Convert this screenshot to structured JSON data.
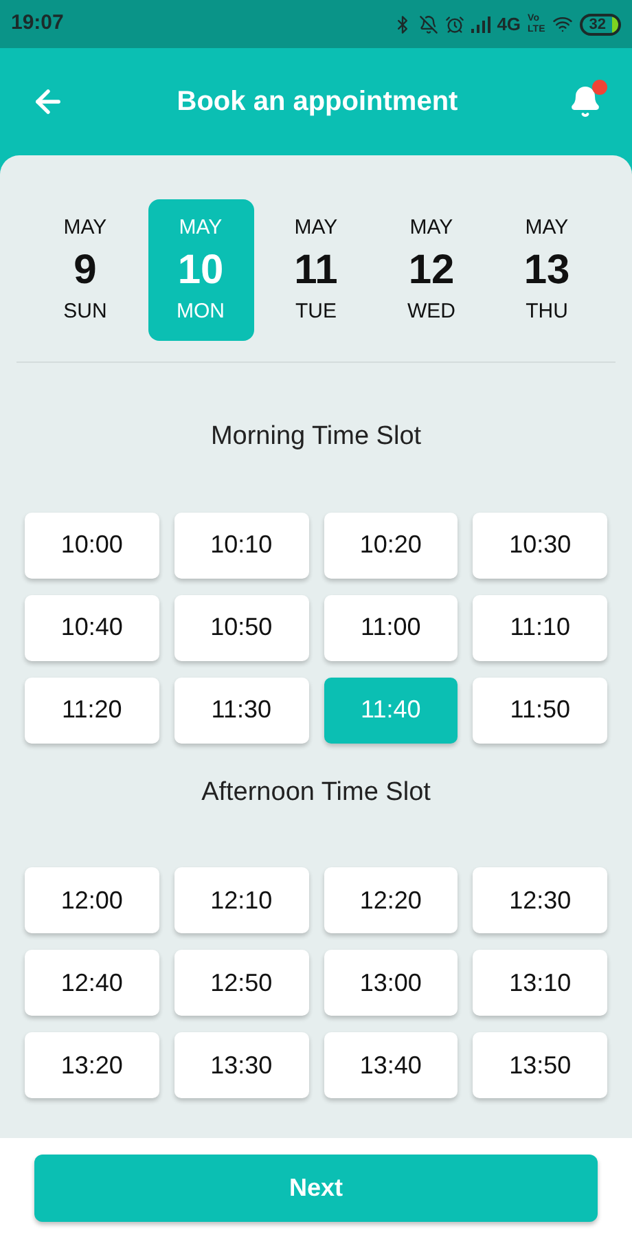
{
  "status_bar": {
    "time": "19:07",
    "network": "4G",
    "volte": [
      "Vo",
      "LTE"
    ],
    "battery": "32"
  },
  "header": {
    "title": "Book an appointment",
    "notification": true
  },
  "dates": [
    {
      "month": "MAY",
      "day": "9",
      "weekday": "SUN",
      "selected": false
    },
    {
      "month": "MAY",
      "day": "10",
      "weekday": "MON",
      "selected": true
    },
    {
      "month": "MAY",
      "day": "11",
      "weekday": "TUE",
      "selected": false
    },
    {
      "month": "MAY",
      "day": "12",
      "weekday": "WED",
      "selected": false
    },
    {
      "month": "MAY",
      "day": "13",
      "weekday": "THU",
      "selected": false
    }
  ],
  "sections": [
    {
      "title": "Morning Time Slot",
      "slots": [
        {
          "time": "10:00",
          "selected": false
        },
        {
          "time": "10:10",
          "selected": false
        },
        {
          "time": "10:20",
          "selected": false
        },
        {
          "time": "10:30",
          "selected": false
        },
        {
          "time": "10:40",
          "selected": false
        },
        {
          "time": "10:50",
          "selected": false
        },
        {
          "time": "11:00",
          "selected": false
        },
        {
          "time": "11:10",
          "selected": false
        },
        {
          "time": "11:20",
          "selected": false
        },
        {
          "time": "11:30",
          "selected": false
        },
        {
          "time": "11:40",
          "selected": true
        },
        {
          "time": "11:50",
          "selected": false
        }
      ]
    },
    {
      "title": "Afternoon Time Slot",
      "slots": [
        {
          "time": "12:00",
          "selected": false
        },
        {
          "time": "12:10",
          "selected": false
        },
        {
          "time": "12:20",
          "selected": false
        },
        {
          "time": "12:30",
          "selected": false
        },
        {
          "time": "12:40",
          "selected": false
        },
        {
          "time": "12:50",
          "selected": false
        },
        {
          "time": "13:00",
          "selected": false
        },
        {
          "time": "13:10",
          "selected": false
        },
        {
          "time": "13:20",
          "selected": false
        },
        {
          "time": "13:30",
          "selected": false
        },
        {
          "time": "13:40",
          "selected": false
        },
        {
          "time": "13:50",
          "selected": false
        }
      ]
    }
  ],
  "next_button": "Next"
}
